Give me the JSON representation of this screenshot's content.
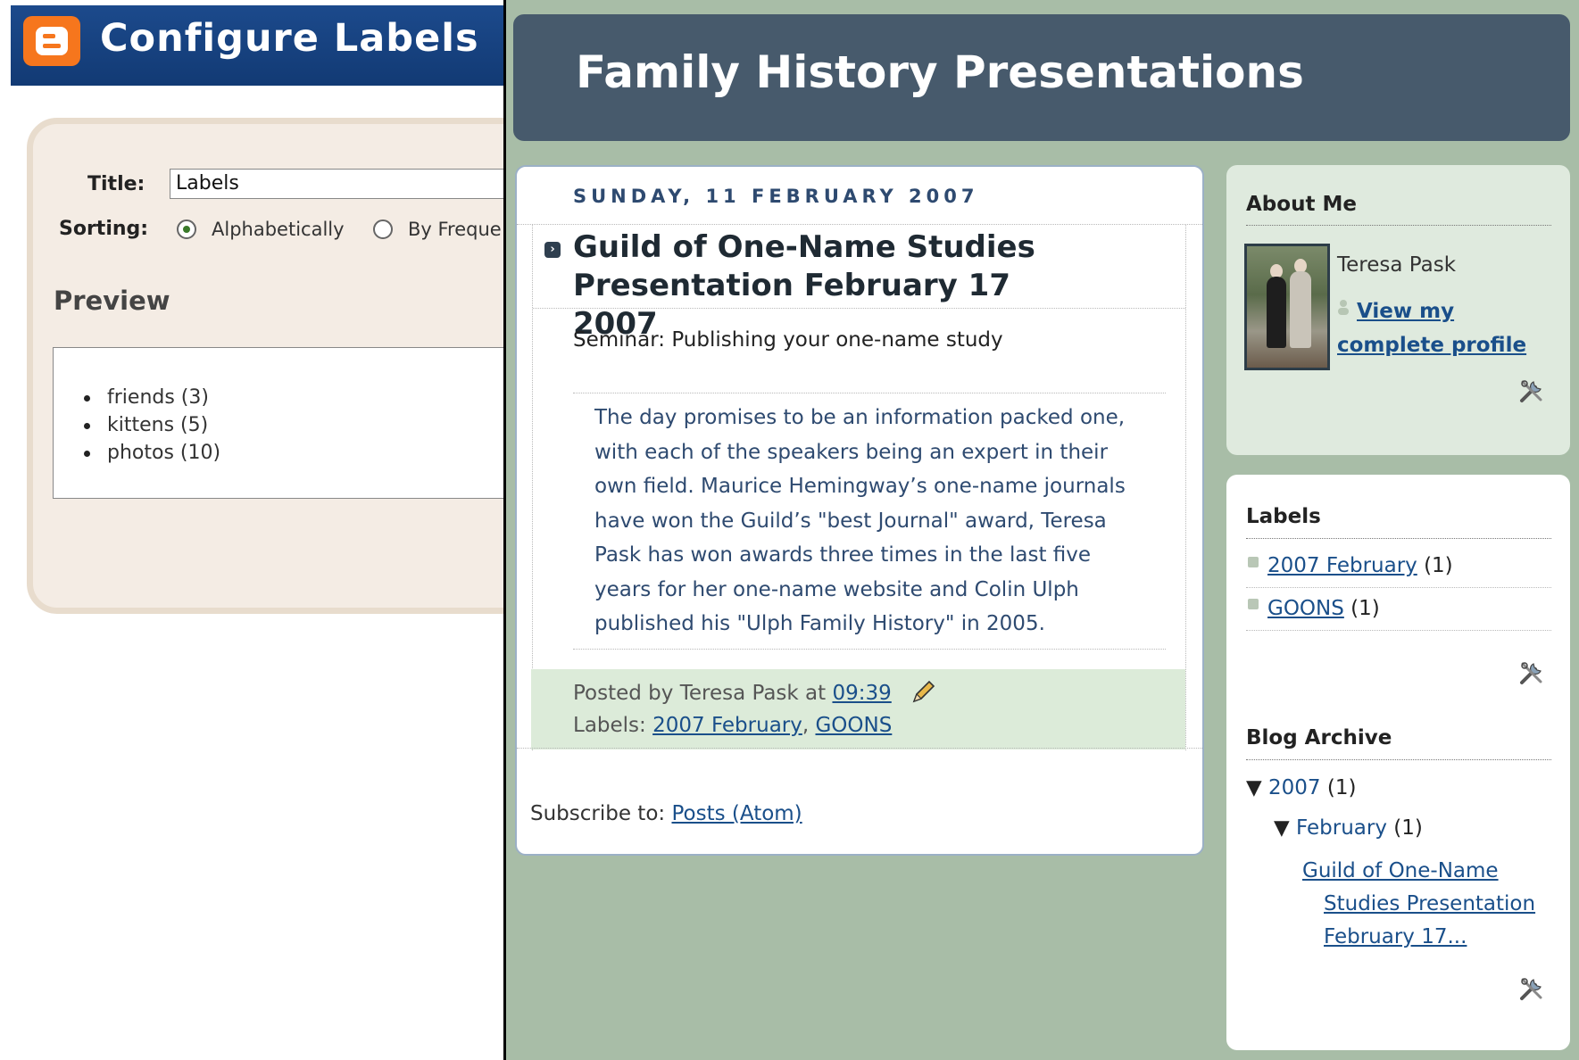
{
  "configure_labels": {
    "title": "Configure Labels",
    "title_field_label": "Title:",
    "title_field_value": "Labels",
    "sorting_label": "Sorting:",
    "sorting_options": [
      "Alphabetically",
      "By Freque"
    ],
    "selected_sorting": "Alphabetically",
    "preview_heading": "Preview",
    "preview_items": [
      "friends (3)",
      "kittens (5)",
      "photos (10)"
    ]
  },
  "blog": {
    "title": "Family History Presentations",
    "post": {
      "date": "SUNDAY, 11 FEBRUARY 2007",
      "title": "Guild of One-Name Studies Presentation February 17 2007",
      "subtitle": "Seminar: Publishing your one-name study",
      "body": "The day promises to be an information packed one, with each of the speakers being an expert in their own field. Maurice Hemingway’s one-name journals have won the Guild’s \"best Journal\" award, Teresa Pask has won awards three times in the last five years for her one-name website and Colin Ulph published his \"Ulph Family History\" in 2005.",
      "posted_by_prefix": "Posted by Teresa Pask at",
      "time": "09:39",
      "labels_prefix": "Labels:",
      "labels": [
        "2007 February",
        "GOONS"
      ],
      "label_separator": ","
    },
    "subscribe_prefix": "Subscribe to:",
    "subscribe_link": "Posts (Atom)",
    "sidebar": {
      "about_heading": "About Me",
      "profile_name": "Teresa Pask",
      "profile_link": "View my complete profile",
      "labels_heading": "Labels",
      "label_items": [
        {
          "name": "2007 February",
          "count": "(1)"
        },
        {
          "name": "GOONS",
          "count": "(1)"
        }
      ],
      "archive_heading": "Blog Archive",
      "archive_year": {
        "toggle": "▼",
        "label": "2007",
        "count": "(1)"
      },
      "archive_month": {
        "toggle": "▼",
        "label": "February",
        "count": "(1)"
      },
      "archive_post": "Guild of One-Name Studies Presentation February 17..."
    }
  },
  "colors": {
    "blogger_orange": "#f6761d",
    "cfg_header_blue": "#1c4a8c",
    "blog_header": "#475a6c",
    "blog_background": "#a8bda7",
    "link": "#1a4f8a"
  },
  "icons": [
    "blogger-logo-icon",
    "post-arrow-icon",
    "pencil-icon",
    "person-icon",
    "tools-icon",
    "triangle-down-icon"
  ]
}
